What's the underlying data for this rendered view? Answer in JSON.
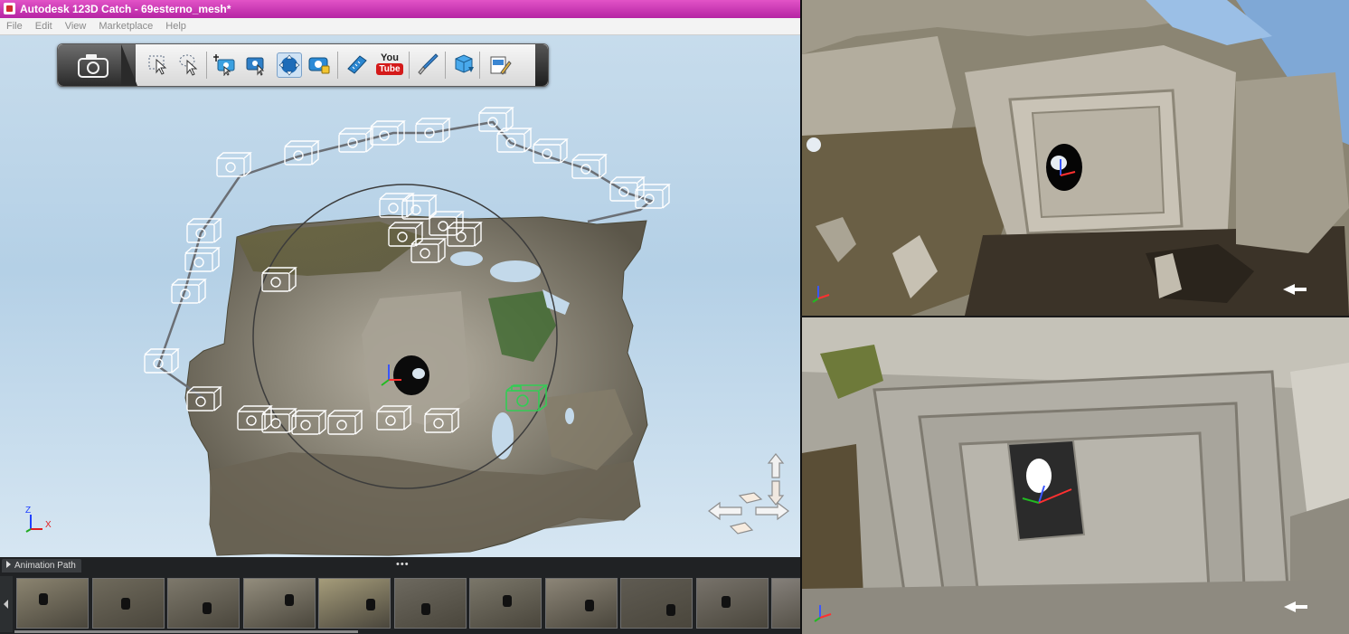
{
  "window": {
    "title": "Autodesk 123D Catch - 69esterno_mesh*"
  },
  "menu": [
    "File",
    "Edit",
    "View",
    "Marketplace",
    "Help"
  ],
  "toolbar": {
    "buttons": [
      {
        "name": "camera-icon"
      },
      {
        "name": "select-icon"
      },
      {
        "name": "lasso-select-icon"
      },
      {
        "name": "add-camera-icon"
      },
      {
        "name": "reference-point-icon"
      },
      {
        "name": "orbit-icon"
      },
      {
        "name": "camera-lock-icon"
      },
      {
        "name": "measure-icon"
      },
      {
        "name": "youtube-icon",
        "label_top": "You",
        "label_bottom": "Tube"
      },
      {
        "name": "brush-icon"
      },
      {
        "name": "export-icon"
      },
      {
        "name": "document-edit-icon"
      }
    ]
  },
  "viewport": {
    "axis_x": "X",
    "axis_z": "Z"
  },
  "animation_panel": {
    "tab_label": "Animation Path",
    "grip": "•••",
    "thumbnail_count": 11
  },
  "colors": {
    "title_bar": "#c83ab8",
    "panel_bg": "#202224",
    "camera_path": "#6b6f75",
    "selected_camera": "#33cc55"
  }
}
